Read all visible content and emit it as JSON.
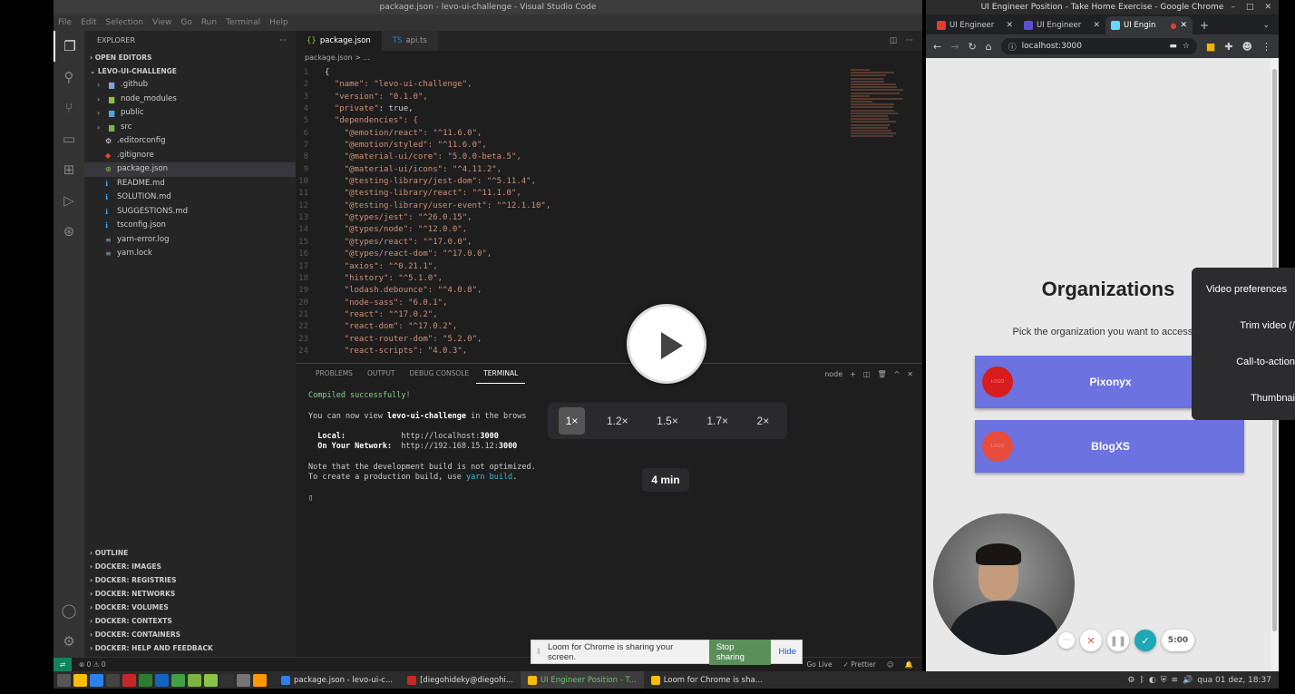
{
  "vscode": {
    "window_title": "package.json - levo-ui-challenge - Visual Studio Code",
    "menu": [
      "File",
      "Edit",
      "Selection",
      "View",
      "Go",
      "Run",
      "Terminal",
      "Help"
    ],
    "explorer_label": "EXPLORER",
    "open_editors": "OPEN EDITORS",
    "project": "LEVO-UI-CHALLENGE",
    "folders": [
      ".github",
      "node_modules",
      "public",
      "src"
    ],
    "files": [
      ".editorconfig",
      ".gitignore",
      "package.json",
      "README.md",
      "SOLUTION.md",
      "SUGGESTIONS.md",
      "tsconfig.json",
      "yarn-error.log",
      "yarn.lock"
    ],
    "bottom_sections": [
      "OUTLINE",
      "DOCKER: IMAGES",
      "DOCKER: REGISTRIES",
      "DOCKER: NETWORKS",
      "DOCKER: VOLUMES",
      "DOCKER: CONTEXTS",
      "DOCKER: CONTAINERS",
      "DOCKER: HELP AND FEEDBACK"
    ],
    "tabs": [
      "package.json",
      "api.ts"
    ],
    "breadcrumb": "package.json > ...",
    "code": [
      {
        "k": "",
        "v": "{"
      },
      {
        "k": "\"name\"",
        "v": ": \"levo-ui-challenge\","
      },
      {
        "k": "\"version\"",
        "v": ": \"0.1.0\","
      },
      {
        "k": "\"private\"",
        "v": ": true,"
      },
      {
        "k": "\"dependencies\"",
        "v": ": {"
      },
      {
        "k": "  \"@emotion/react\"",
        "v": ": \"^11.6.0\","
      },
      {
        "k": "  \"@emotion/styled\"",
        "v": ": \"^11.6.0\","
      },
      {
        "k": "  \"@material-ui/core\"",
        "v": ": \"5.0.0-beta.5\","
      },
      {
        "k": "  \"@material-ui/icons\"",
        "v": ": \"^4.11.2\","
      },
      {
        "k": "  \"@testing-library/jest-dom\"",
        "v": ": \"^5.11.4\","
      },
      {
        "k": "  \"@testing-library/react\"",
        "v": ": \"^11.1.0\","
      },
      {
        "k": "  \"@testing-library/user-event\"",
        "v": ": \"^12.1.10\","
      },
      {
        "k": "  \"@types/jest\"",
        "v": ": \"^26.0.15\","
      },
      {
        "k": "  \"@types/node\"",
        "v": ": \"^12.0.0\","
      },
      {
        "k": "  \"@types/react\"",
        "v": ": \"^17.0.0\","
      },
      {
        "k": "  \"@types/react-dom\"",
        "v": ": \"^17.0.0\","
      },
      {
        "k": "  \"axios\"",
        "v": ": \"^0.21.1\","
      },
      {
        "k": "  \"history\"",
        "v": ": \"^5.1.0\","
      },
      {
        "k": "  \"lodash.debounce\"",
        "v": ": \"^4.0.8\","
      },
      {
        "k": "  \"node-sass\"",
        "v": ": \"6.0.1\","
      },
      {
        "k": "  \"react\"",
        "v": ": \"^17.0.2\","
      },
      {
        "k": "  \"react-dom\"",
        "v": ": \"^17.0.2\","
      },
      {
        "k": "  \"react-router-dom\"",
        "v": ": \"5.2.0\","
      },
      {
        "k": "  \"react-scripts\"",
        "v": ": \"4.0.3\","
      }
    ],
    "panel_tabs": [
      "PROBLEMS",
      "OUTPUT",
      "DEBUG CONSOLE",
      "TERMINAL"
    ],
    "panel_shell": "node",
    "terminal": {
      "compiled": "Compiled successfully!",
      "view_pre": "You can now view ",
      "view_app": "levo-ui-challenge",
      "view_post": " in the brows",
      "local_label": "  Local:            ",
      "local_url": "http://localhost:",
      "local_port": "3000",
      "network_label": "  On Your Network:  ",
      "network_url": "http://192.168.15.12:",
      "network_port": "3000",
      "note1": "Note that the development build is not optimized.",
      "note2_pre": "To create a production build, use ",
      "note2_cmd": "yarn build",
      "note2_post": "."
    },
    "status": {
      "problems": "⊗ 0 ⚠ 0",
      "golive": "Go Live",
      "prettier": "✓ Prettier"
    }
  },
  "chrome": {
    "window_title": "UI Engineer Position - Take Home Exercise - Google Chrome",
    "tabs": [
      {
        "label": "UI Engineer",
        "color": "#e53935"
      },
      {
        "label": "UI Engineer",
        "color": "#5b4fd8"
      },
      {
        "label": "UI Engin",
        "color": "#61dafb"
      }
    ],
    "url": "localhost:3000",
    "page": {
      "title": "Organizations",
      "subtitle": "Pick the organization you want to access to",
      "orgs": [
        {
          "name": "Pixonyx",
          "avatar_color": "#d81b1b"
        },
        {
          "name": "BlogXS",
          "avatar_color": "#e74c3c"
        }
      ]
    }
  },
  "loom": {
    "menu": [
      "Video preferences",
      "Trim video (/",
      "Call-to-action",
      "Thumbnai"
    ],
    "speeds": [
      "1×",
      "1.2×",
      "1.5×",
      "1.7×",
      "2×"
    ],
    "active_speed": "1×",
    "duration": "4 min",
    "timer": "5:00",
    "share_text": "Loom for Chrome is sharing your screen.",
    "stop_label": "Stop sharing",
    "hide_label": "Hide"
  },
  "taskbar": {
    "tasks": [
      {
        "label": "package.json - levo-ui-c...",
        "color": "#2f80ed"
      },
      {
        "label": "[diegohideky@diegohi...",
        "color": "#c62828"
      },
      {
        "label": "UI Engineer Position - T...",
        "color": "#fbbc04"
      },
      {
        "label": "Loom for Chrome is sha...",
        "color": "#fbbc04"
      }
    ],
    "clock": "qua 01 dez, 18:37"
  }
}
